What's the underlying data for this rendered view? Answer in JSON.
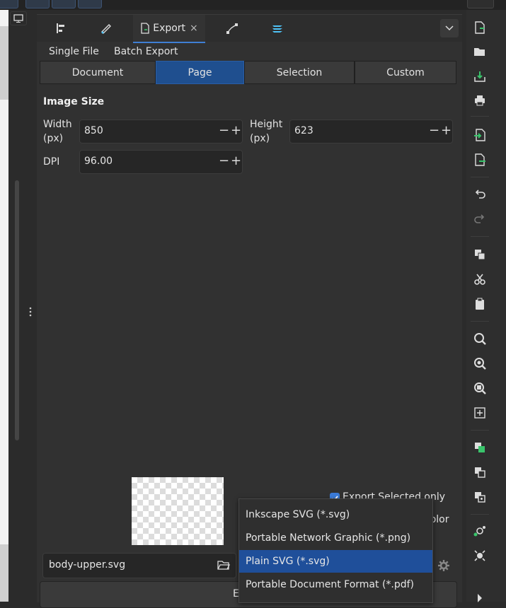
{
  "dialog": {
    "tabs": [
      {
        "icon": "align-icon"
      },
      {
        "icon": "fill-stroke-icon"
      },
      {
        "icon": "export-icon",
        "label": "Export",
        "close": "×"
      },
      {
        "icon": "node-editor-icon"
      },
      {
        "icon": "layers-icon"
      }
    ]
  },
  "export": {
    "mode_tabs": [
      "Single File",
      "Batch Export"
    ],
    "area_buttons": [
      "Document",
      "Page",
      "Selection",
      "Custom"
    ],
    "active_area": "Page",
    "image_size_title": "Image Size",
    "width_label": "Width\n(px)",
    "width_value": "850",
    "height_label": "Height\n(px)",
    "height_value": "623",
    "dpi_label": "DPI",
    "dpi_value": "96.00",
    "export_selected_label": "Export Selected only",
    "color_label": "color",
    "filename": "body-upper.svg",
    "export_button": "E"
  },
  "format_dropdown": {
    "options": [
      "Inkscape SVG (*.svg)",
      "Portable Network Graphic (*.png)",
      "Plain SVG (*.svg)",
      "Portable Document Format (*.pdf)"
    ],
    "selected": "Plain SVG (*.svg)"
  },
  "colors": {
    "accent": "#3f7fd4",
    "selected_bg": "#1f4f9a"
  }
}
